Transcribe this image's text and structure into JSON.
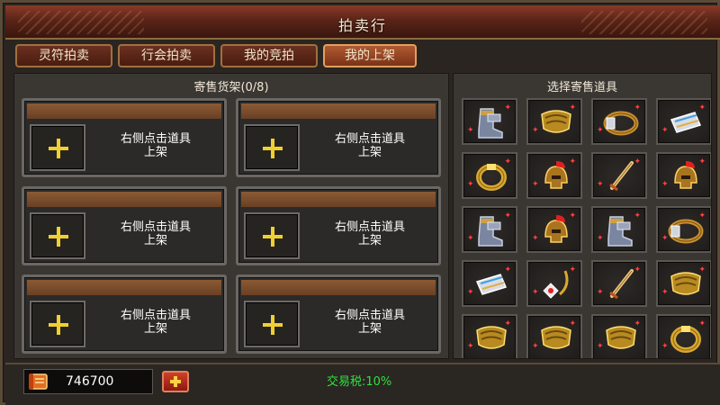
{
  "window": {
    "title": "拍卖行"
  },
  "tabs": [
    {
      "label": "灵符拍卖",
      "selected": false
    },
    {
      "label": "行会拍卖",
      "selected": false
    },
    {
      "label": "我的竞拍",
      "selected": false
    },
    {
      "label": "我的上架",
      "selected": true
    }
  ],
  "consign_panel": {
    "title": "寄售货架(0/8)",
    "slots": [
      {
        "hint_line1": "右侧点击道具",
        "hint_line2": "上架"
      },
      {
        "hint_line1": "右侧点击道具",
        "hint_line2": "上架"
      },
      {
        "hint_line1": "右侧点击道具",
        "hint_line2": "上架"
      },
      {
        "hint_line1": "右侧点击道具",
        "hint_line2": "上架"
      },
      {
        "hint_line1": "右侧点击道具",
        "hint_line2": "上架"
      },
      {
        "hint_line1": "右侧点击道具",
        "hint_line2": "上架"
      }
    ]
  },
  "item_panel": {
    "title": "选择寄售道具",
    "items": [
      {
        "icon": "boots-icon"
      },
      {
        "icon": "armor-icon"
      },
      {
        "icon": "belt-icon"
      },
      {
        "icon": "bracer-icon"
      },
      {
        "icon": "ring-icon"
      },
      {
        "icon": "helmet-icon"
      },
      {
        "icon": "sword-icon"
      },
      {
        "icon": "helmet-icon"
      },
      {
        "icon": "boots-icon"
      },
      {
        "icon": "helmet-icon"
      },
      {
        "icon": "boots-icon"
      },
      {
        "icon": "belt-icon"
      },
      {
        "icon": "bracer-icon"
      },
      {
        "icon": "necklace-icon"
      },
      {
        "icon": "sword-icon"
      },
      {
        "icon": "armor-icon"
      },
      {
        "icon": "armor-icon"
      },
      {
        "icon": "armor-icon"
      },
      {
        "icon": "armor-icon"
      },
      {
        "icon": "ring-icon"
      }
    ]
  },
  "footer": {
    "currency_icon": "scroll-icon",
    "currency_value": "746700",
    "tax_label": "交易税:10%"
  },
  "colors": {
    "tab_selected": "#b05a30",
    "slot_bar": "#8a5a34",
    "plus": "#f0d030",
    "tax_text": "#30e040",
    "title_bar": "#5a2418"
  }
}
